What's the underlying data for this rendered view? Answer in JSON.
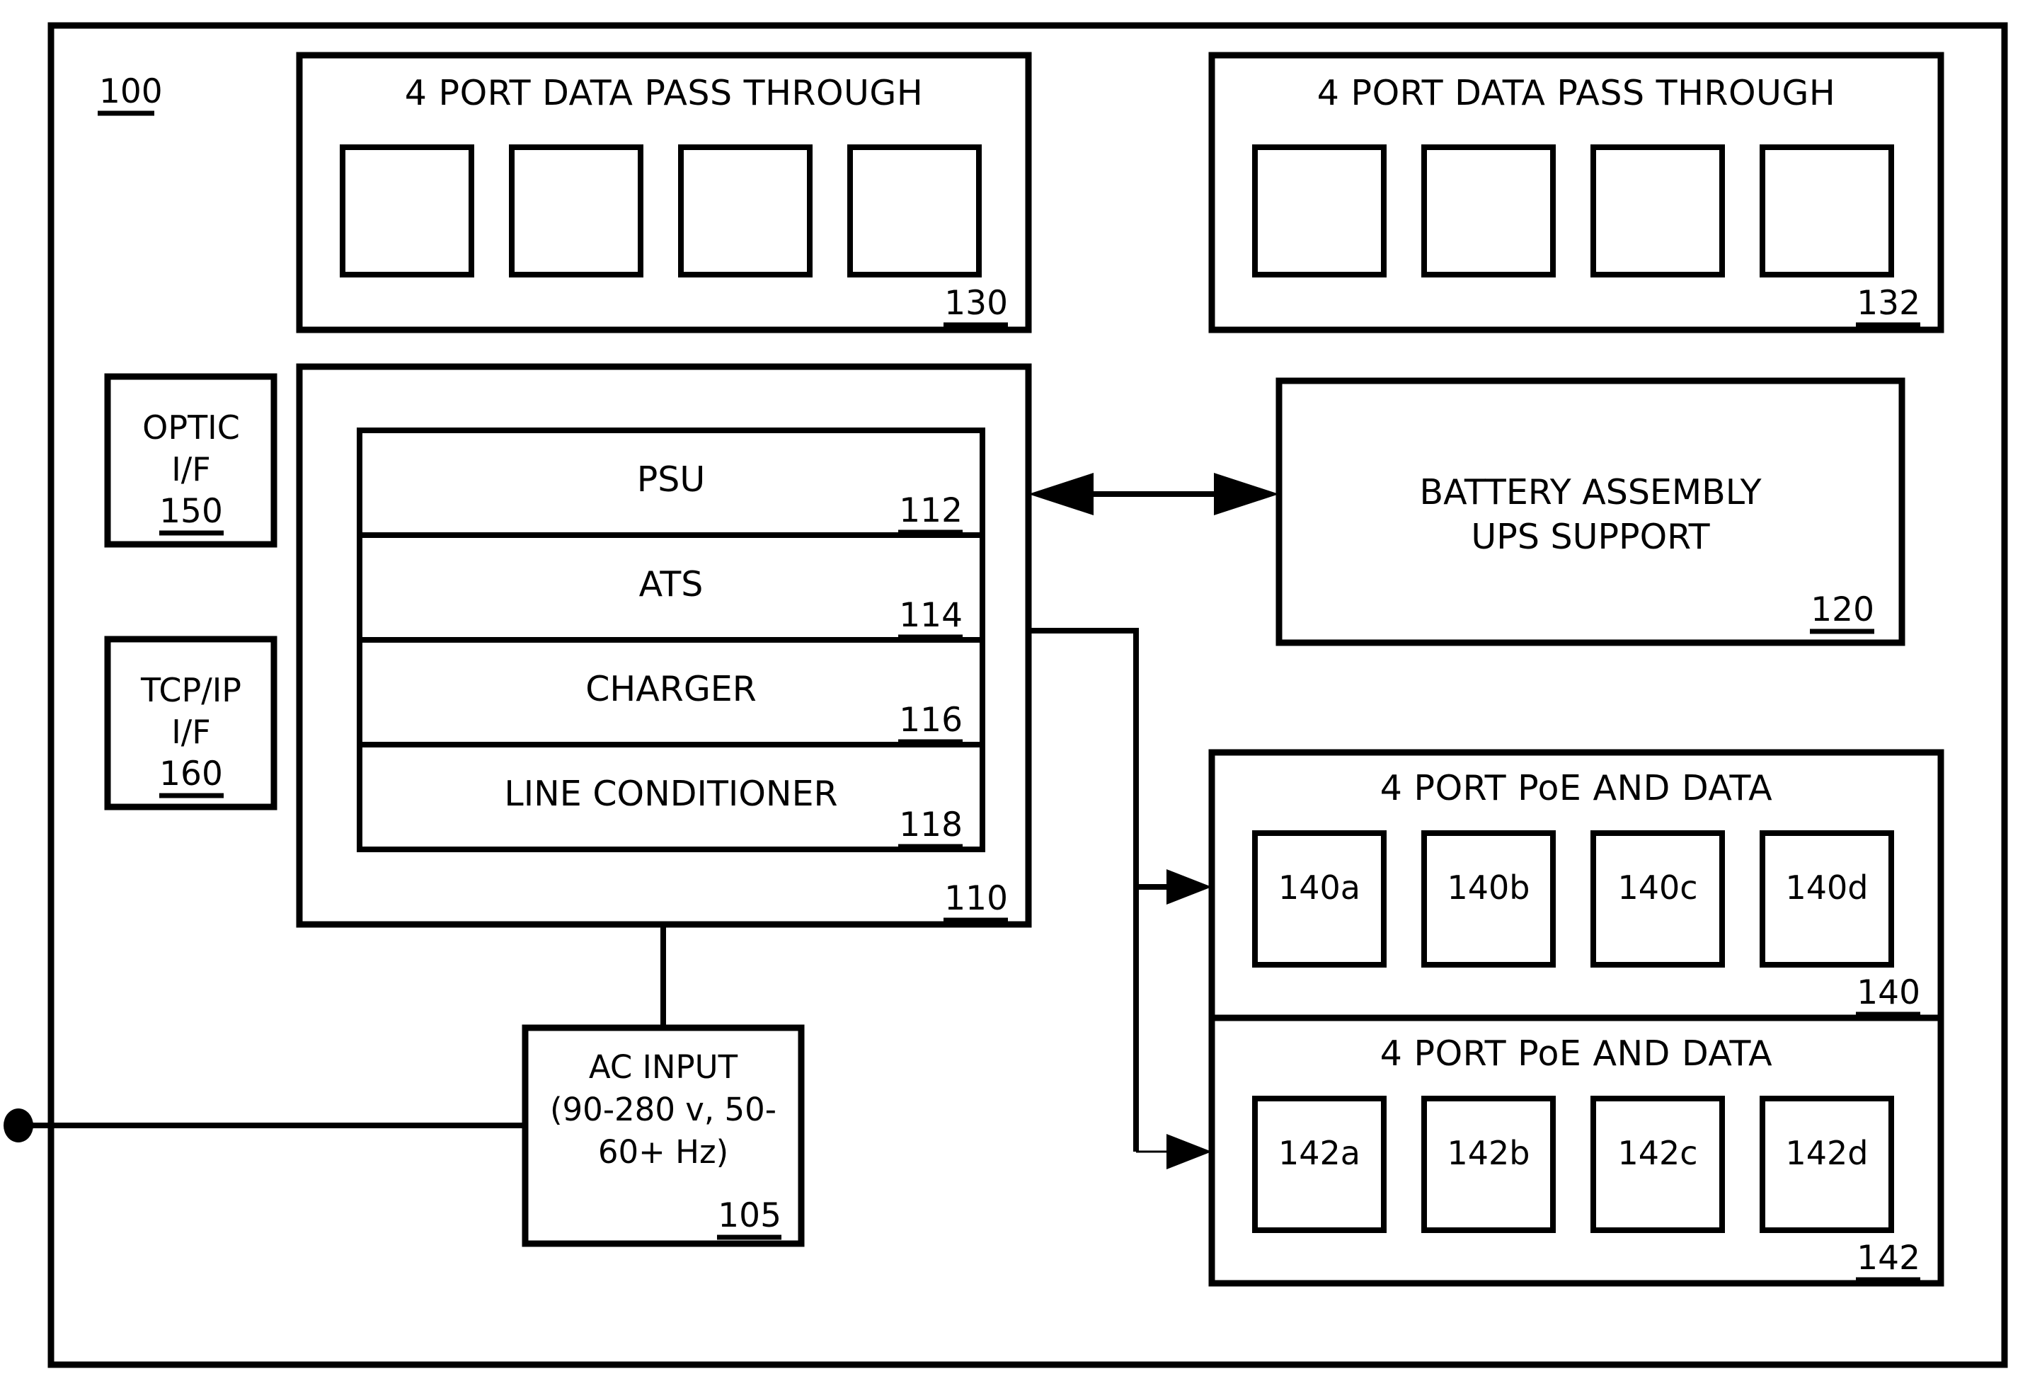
{
  "figure": {
    "ref_label": "100"
  },
  "pass_through_left": {
    "title": "4 PORT DATA PASS THROUGH",
    "ref": "130",
    "ports": [
      "",
      "",
      "",
      ""
    ]
  },
  "pass_through_right": {
    "title": "4 PORT DATA PASS THROUGH",
    "ref": "132",
    "ports": [
      "",
      "",
      "",
      ""
    ]
  },
  "optic_interface": {
    "line1": "OPTIC",
    "line2": "I/F",
    "ref": "150"
  },
  "tcpip_interface": {
    "line1": "TCP/IP",
    "line2": "I/F",
    "ref": "160"
  },
  "power_unit": {
    "ref": "110",
    "modules": [
      {
        "label": "PSU",
        "ref": "112"
      },
      {
        "label": "ATS",
        "ref": "114"
      },
      {
        "label": "CHARGER",
        "ref": "116"
      },
      {
        "label": "LINE CONDITIONER",
        "ref": "118"
      }
    ]
  },
  "battery": {
    "line1": "BATTERY ASSEMBLY",
    "line2": "UPS SUPPORT",
    "ref": "120"
  },
  "poe_upper": {
    "title": "4 PORT PoE AND DATA",
    "ref": "140",
    "ports": [
      "140a",
      "140b",
      "140c",
      "140d"
    ]
  },
  "poe_lower": {
    "title": "4 PORT PoE AND DATA",
    "ref": "142",
    "ports": [
      "142a",
      "142b",
      "142c",
      "142d"
    ]
  },
  "ac_input": {
    "line1": "AC INPUT",
    "line2": "(90-280 v, 50-",
    "line3": "60+ Hz)",
    "ref": "105"
  },
  "colors": {
    "stroke": "#000000",
    "background": "#ffffff"
  }
}
